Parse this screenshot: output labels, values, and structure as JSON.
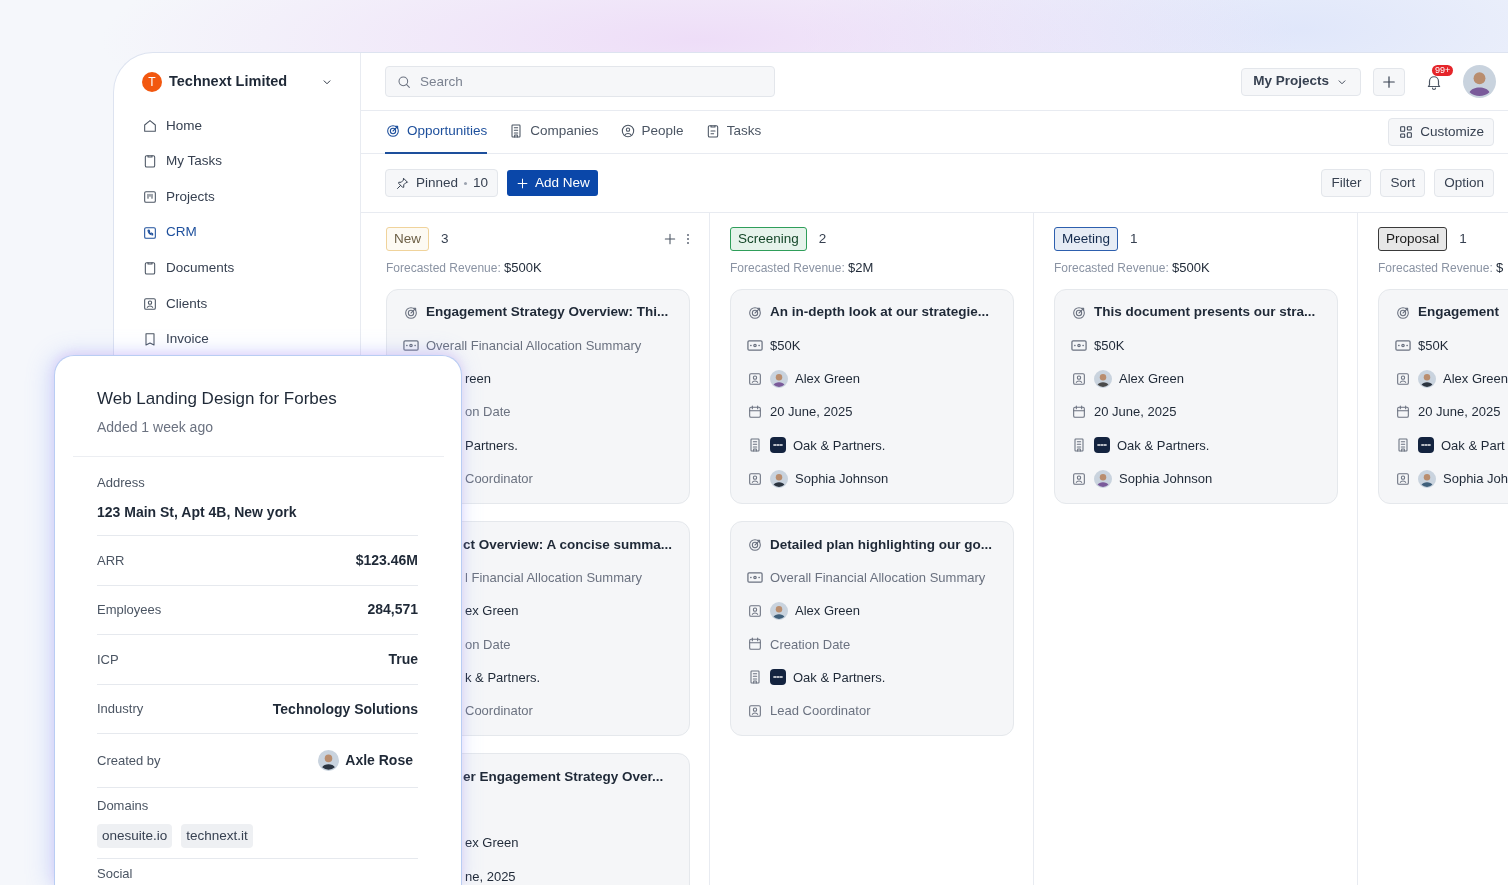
{
  "workspace": {
    "initial": "T",
    "name": "Technext Limited"
  },
  "sidebar": {
    "items": [
      {
        "label": "Home",
        "selected": false
      },
      {
        "label": "My Tasks",
        "selected": false
      },
      {
        "label": "Projects",
        "selected": false
      },
      {
        "label": "CRM",
        "selected": true
      },
      {
        "label": "Documents",
        "selected": false
      },
      {
        "label": "Clients",
        "selected": false
      },
      {
        "label": "Invoice",
        "selected": false
      }
    ]
  },
  "topbar": {
    "search": {
      "placeholder": "Search"
    },
    "project_menu": "My Projects",
    "notification_badge": "99+"
  },
  "tabs": [
    {
      "label": "Opportunities",
      "selected": true
    },
    {
      "label": "Companies",
      "selected": false
    },
    {
      "label": "People",
      "selected": false
    },
    {
      "label": "Tasks",
      "selected": false
    }
  ],
  "customize": "Customize",
  "toolbar": {
    "pinned_label": "Pinned",
    "pinned_count": "10",
    "add_new": "Add New",
    "actions": [
      "Filter",
      "Sort",
      "Option"
    ]
  },
  "columns": [
    {
      "status": "New",
      "color": "#f0d39b",
      "count": "3",
      "forecast_label": "Forecasted Revenue:",
      "forecast_value": "$500K",
      "hovered": true,
      "cards": [
        {
          "title": "Engagement Strategy Overview: Thi...",
          "title_clipped": false,
          "rows": [
            {
              "kind": "money",
              "text": "Overall Financial Allocation Summary",
              "empty": true,
              "clipped": false
            },
            {
              "kind": "person",
              "text": "reen",
              "empty": false,
              "clipped": true
            },
            {
              "kind": "date",
              "text": "on Date",
              "empty": true,
              "clipped": true
            },
            {
              "kind": "company",
              "text": "Partners.",
              "empty": false,
              "clipped": true
            },
            {
              "kind": "contact",
              "text": "Coordinator",
              "empty": true,
              "clipped": true
            }
          ]
        },
        {
          "title": "ct Overview: A concise summa...",
          "title_clipped": true,
          "rows": [
            {
              "kind": "money",
              "text": "l Financial Allocation Summary",
              "empty": true,
              "clipped": true
            },
            {
              "kind": "person",
              "text": "ex Green",
              "empty": false,
              "clipped": true
            },
            {
              "kind": "date",
              "text": "on Date",
              "empty": true,
              "clipped": true
            },
            {
              "kind": "company",
              "text": "k & Partners.",
              "empty": false,
              "clipped": true
            },
            {
              "kind": "contact",
              "text": "Coordinator",
              "empty": true,
              "clipped": true
            }
          ]
        },
        {
          "title": "er Engagement Strategy Over...",
          "title_clipped": true,
          "rows": [
            {
              "kind": "blank"
            },
            {
              "kind": "person",
              "text": "ex Green",
              "empty": false,
              "clipped": true
            },
            {
              "kind": "date",
              "text": "ne, 2025",
              "empty": false,
              "clipped": true
            }
          ]
        }
      ]
    },
    {
      "status": "Screening",
      "color": "#2f9e5a",
      "count": "2",
      "forecast_label": "Forecasted Revenue:",
      "forecast_value": "$2M",
      "hovered": false,
      "cards": [
        {
          "title": "An in-depth look at our strategie...",
          "title_clipped": false,
          "rows": [
            {
              "kind": "money",
              "text": "$50K",
              "empty": false,
              "clipped": false
            },
            {
              "kind": "person",
              "text": "Alex Green",
              "empty": false,
              "clipped": false
            },
            {
              "kind": "date",
              "text": "20 June, 2025",
              "empty": false,
              "clipped": false
            },
            {
              "kind": "company",
              "text": "Oak & Partners.",
              "empty": false,
              "clipped": false
            },
            {
              "kind": "contact",
              "text": "Sophia Johnson",
              "empty": false,
              "clipped": false
            }
          ]
        },
        {
          "title": "Detailed plan highlighting our go...",
          "title_clipped": false,
          "rows": [
            {
              "kind": "money",
              "text": "Overall Financial Allocation Summary",
              "empty": true,
              "clipped": false
            },
            {
              "kind": "person",
              "text": "Alex Green",
              "empty": false,
              "clipped": false
            },
            {
              "kind": "date",
              "text": "Creation Date",
              "empty": true,
              "clipped": false
            },
            {
              "kind": "company",
              "text": "Oak & Partners.",
              "empty": false,
              "clipped": false
            },
            {
              "kind": "contact",
              "text": "Lead Coordinator",
              "empty": true,
              "clipped": false
            }
          ]
        }
      ]
    },
    {
      "status": "Meeting",
      "color": "#2d5fae",
      "count": "1",
      "forecast_label": "Forecasted Revenue:",
      "forecast_value": "$500K",
      "hovered": false,
      "cards": [
        {
          "title": "This document presents our stra...",
          "title_clipped": false,
          "rows": [
            {
              "kind": "money",
              "text": "$50K",
              "empty": false,
              "clipped": false
            },
            {
              "kind": "person",
              "text": "Alex Green",
              "empty": false,
              "clipped": false
            },
            {
              "kind": "date",
              "text": "20 June, 2025",
              "empty": false,
              "clipped": false
            },
            {
              "kind": "company",
              "text": "Oak & Partners.",
              "empty": false,
              "clipped": false
            },
            {
              "kind": "contact",
              "text": "Sophia Johnson",
              "empty": false,
              "clipped": false
            }
          ]
        }
      ]
    },
    {
      "status": "Proposal",
      "color": "#3a3a3a",
      "count": "1",
      "forecast_label": "Forecasted Revenue:",
      "forecast_value": "$",
      "cards": [
        {
          "title": "Engagement",
          "title_clipped": false,
          "rows": [
            {
              "kind": "money",
              "text": "$50K",
              "empty": false,
              "clipped": false
            },
            {
              "kind": "person",
              "text": "Alex Green",
              "empty": false,
              "clipped": false
            },
            {
              "kind": "date",
              "text": "20 June, 2025",
              "empty": false,
              "clipped": false
            },
            {
              "kind": "company",
              "text": "Oak & Part",
              "empty": false,
              "clipped": false
            },
            {
              "kind": "contact",
              "text": "Sophia Joh",
              "empty": false,
              "clipped": false
            }
          ]
        }
      ]
    }
  ],
  "detail": {
    "title": "Web Landing Design for Forbes",
    "subtitle": "Added 1 week ago",
    "address_label": "Address",
    "address": "123 Main St, Apt 4B, New york",
    "fields": [
      {
        "kind": "text",
        "label": "ARR",
        "value": "$123.46M"
      },
      {
        "kind": "text",
        "label": "Employees",
        "value": "284,571"
      },
      {
        "kind": "text",
        "label": "ICP",
        "value": "True"
      },
      {
        "kind": "text",
        "label": "Industry",
        "value": "Technology Solutions"
      },
      {
        "kind": "person",
        "label": "Created by",
        "value": "Axle Rose"
      }
    ],
    "domains_label": "Domains",
    "domains": [
      "onesuite.io",
      "technext.it"
    ],
    "social_label": "Social"
  }
}
